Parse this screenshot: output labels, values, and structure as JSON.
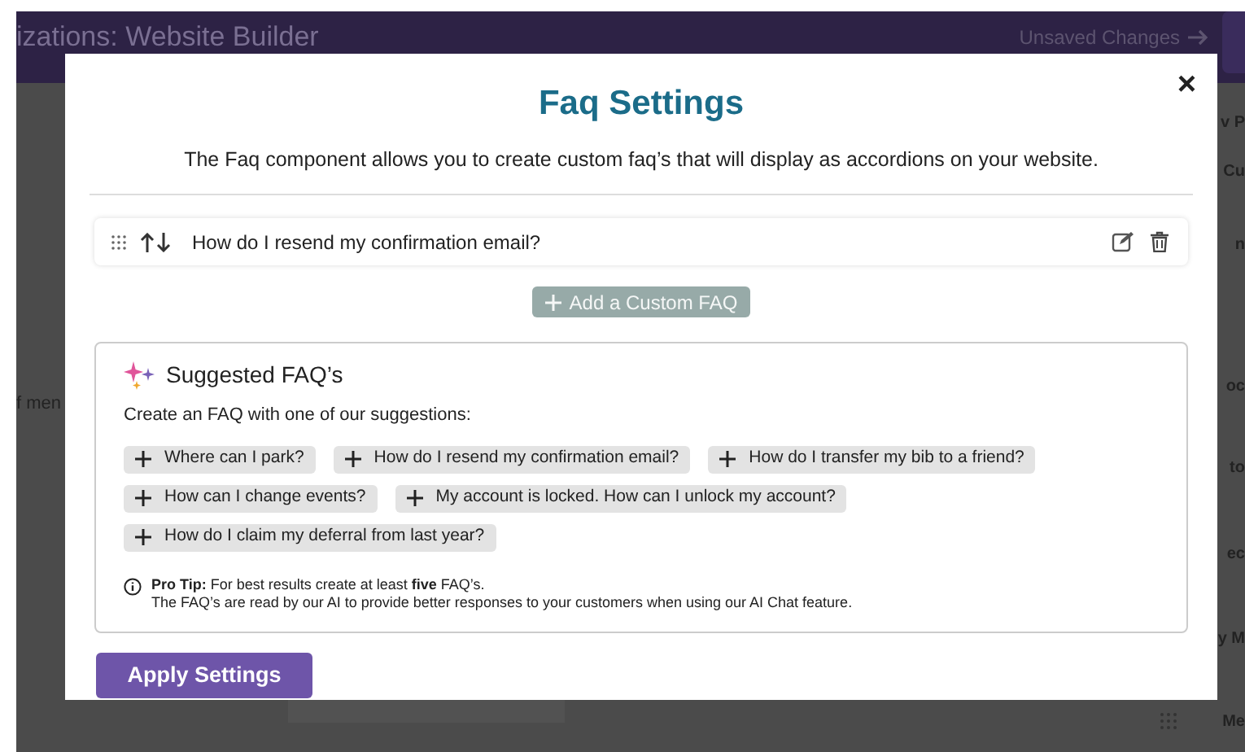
{
  "background": {
    "header_title": "izations: Website Builder",
    "unsaved": "Unsaved Changes",
    "left_texts": [
      "f men"
    ],
    "right_texts": [
      "v P",
      "Cu",
      "n",
      "oc",
      "to",
      "ec",
      "y M",
      "Me"
    ]
  },
  "modal": {
    "title": "Faq Settings",
    "close": "×",
    "description": "The Faq component allows you to create custom faq’s that will display as accordions on your website.",
    "faqs": [
      {
        "question": "How do I resend my confirmation email?"
      }
    ],
    "add_button": "Add a Custom FAQ",
    "suggested": {
      "title": "Suggested FAQ’s",
      "intro": "Create an FAQ with one of our suggestions:",
      "chips": [
        "Where can I park?",
        "How do I resend my confirmation email?",
        "How do I transfer my bib to a friend?",
        "How can I change events?",
        "My account is locked. How can I unlock my account?",
        "How do I claim my deferral from last year?"
      ],
      "tip": "**Pro Tip:** For best results create at least **five** FAQ’s.",
      "tip_2": "The FAQ’s are read by our AI to provide better responses to your customers when using our AI Chat feature."
    },
    "apply_button": "Apply Settings"
  }
}
